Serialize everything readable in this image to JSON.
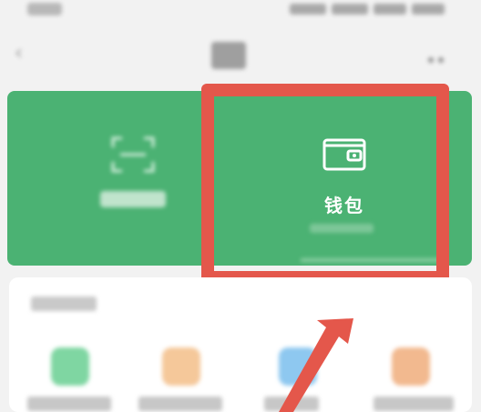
{
  "wallet": {
    "label": "钱包"
  },
  "icons": {
    "back": "back-arrow-icon",
    "more": "more-icon",
    "scan": "scan-icon",
    "wallet": "wallet-icon",
    "arrow": "pointer-arrow-icon"
  },
  "colors": {
    "banner_green": "#4bb273",
    "highlight_red": "#e4574b",
    "background": "#f2f2f2",
    "card": "#ffffff",
    "service_icon_1": "#7fd6a2",
    "service_icon_2": "#f5c89a",
    "service_icon_3": "#8ec8f0",
    "service_icon_4": "#f2b98f"
  }
}
